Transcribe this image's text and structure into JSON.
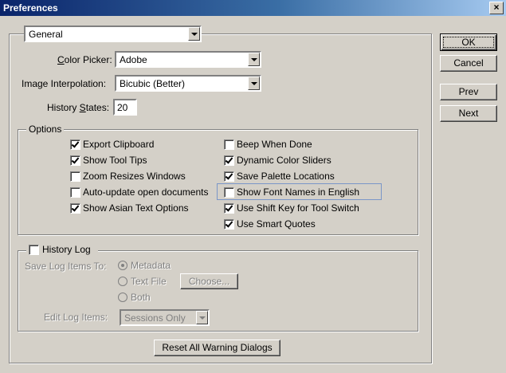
{
  "window": {
    "title": "Preferences",
    "close_label": "×"
  },
  "general_combo": {
    "value": "General"
  },
  "color_picker": {
    "label": "Color Picker:",
    "value": "Adobe"
  },
  "interpolation": {
    "label": "Image Interpolation:",
    "value": "Bicubic (Better)"
  },
  "history_states": {
    "label": "History States:",
    "value": "20"
  },
  "options": {
    "title": "Options",
    "left": [
      {
        "label": "Export Clipboard",
        "checked": true
      },
      {
        "label": "Show Tool Tips",
        "checked": true
      },
      {
        "label": "Zoom Resizes Windows",
        "checked": false
      },
      {
        "label": "Auto-update open documents",
        "checked": false
      },
      {
        "label": "Show Asian Text Options",
        "checked": true
      }
    ],
    "right": [
      {
        "label": "Beep When Done",
        "checked": false
      },
      {
        "label": "Dynamic Color Sliders",
        "checked": true
      },
      {
        "label": "Save Palette Locations",
        "checked": true
      },
      {
        "label": "Show Font Names in English",
        "checked": false
      },
      {
        "label": "Use Shift Key for Tool Switch",
        "checked": true
      },
      {
        "label": "Use Smart Quotes",
        "checked": true
      }
    ]
  },
  "history_log": {
    "title": "History Log",
    "checked": false,
    "save_to_label": "Save Log Items To:",
    "radios": [
      {
        "label": "Metadata",
        "checked": true
      },
      {
        "label": "Text File",
        "checked": false
      },
      {
        "label": "Both",
        "checked": false
      }
    ],
    "choose_label": "Choose...",
    "edit_label": "Edit Log Items:",
    "edit_value": "Sessions Only"
  },
  "reset_button": {
    "label": "Reset All Warning Dialogs"
  },
  "buttons": {
    "ok": "OK",
    "cancel": "Cancel",
    "prev": "Prev",
    "next": "Next"
  }
}
